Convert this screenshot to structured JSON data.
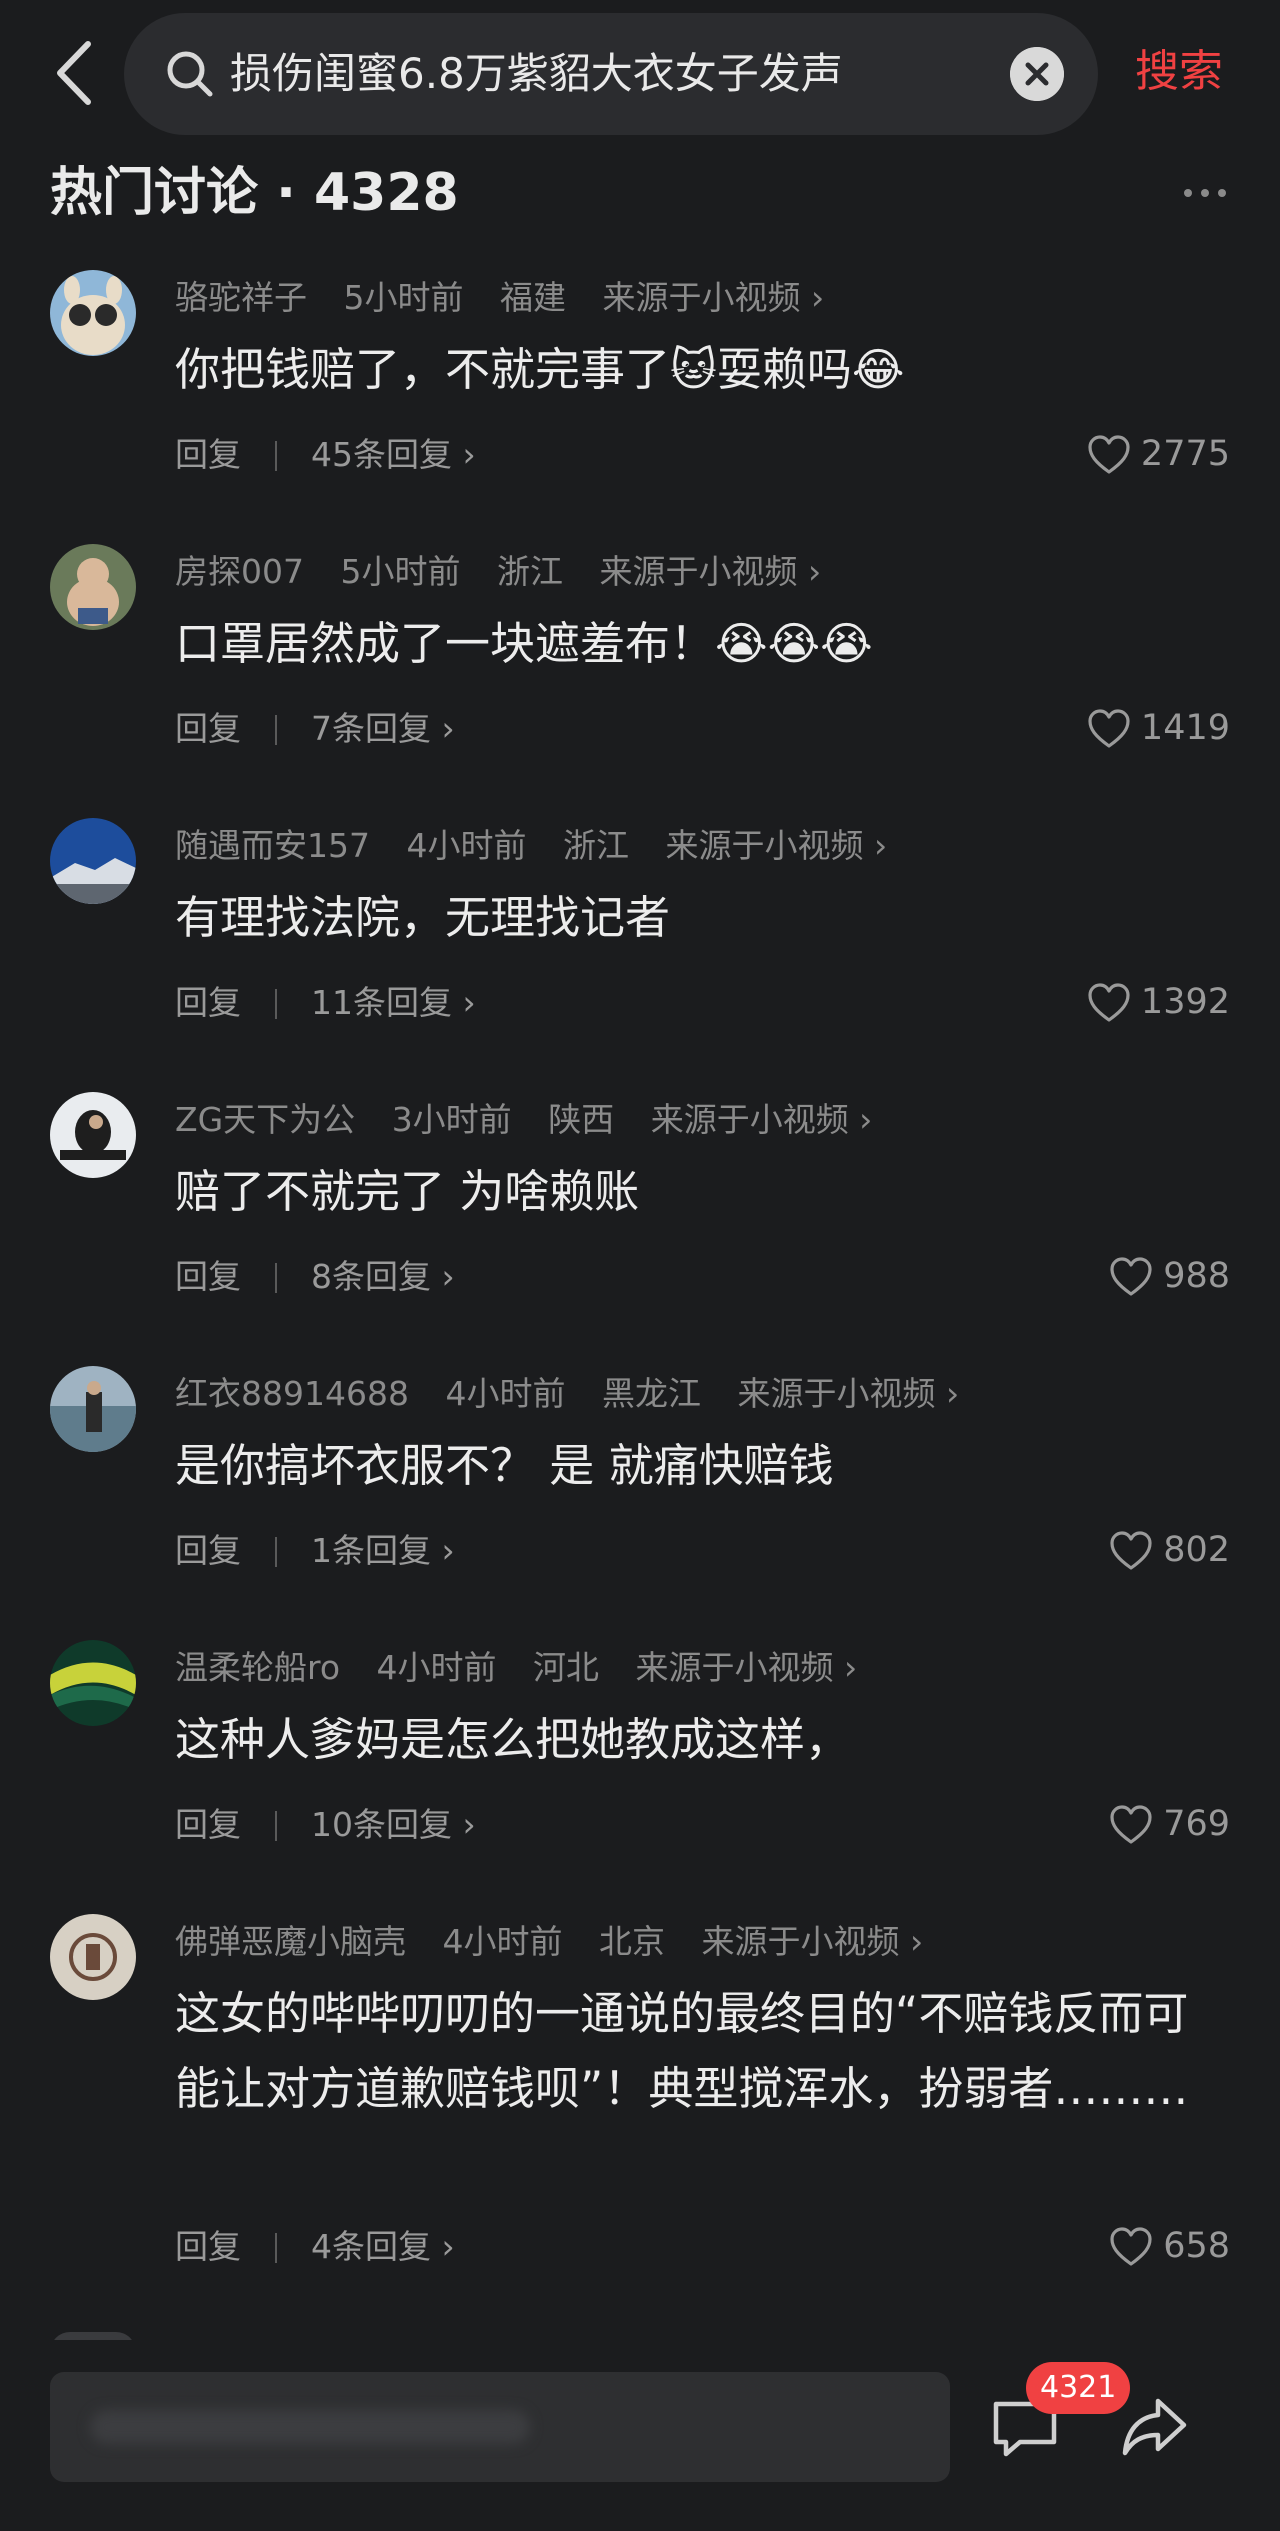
{
  "search": {
    "query": "损伤闺蜜6.8万紫貂大衣女子发声",
    "button_label": "搜索"
  },
  "section": {
    "title": "热门讨论 · 4328"
  },
  "comments": [
    {
      "user": "骆驼祥子",
      "time": "5小时前",
      "location": "福建",
      "source": "来源于小视频 ›",
      "text": "你把钱赔了，不就完事了🐱耍赖吗😂",
      "reply_label": "回复",
      "replies": "45条回复 ›",
      "likes": "2775"
    },
    {
      "user": "房探007",
      "time": "5小时前",
      "location": "浙江",
      "source": "来源于小视频 ›",
      "text": "口罩居然成了一块遮羞布！😭😭😭",
      "reply_label": "回复",
      "replies": "7条回复 ›",
      "likes": "1419"
    },
    {
      "user": "随遇而安157",
      "time": "4小时前",
      "location": "浙江",
      "source": "来源于小视频 ›",
      "text": "有理找法院，无理找记者",
      "reply_label": "回复",
      "replies": "11条回复 ›",
      "likes": "1392"
    },
    {
      "user": "ZG天下为公",
      "time": "3小时前",
      "location": "陕西",
      "source": "来源于小视频 ›",
      "text": "赔了不就完了 为啥赖账",
      "reply_label": "回复",
      "replies": "8条回复 ›",
      "likes": "988"
    },
    {
      "user": "红衣88914688",
      "time": "4小时前",
      "location": "黑龙江",
      "source": "来源于小视频 ›",
      "text": "是你搞坏衣服不？ 是 就痛快赔钱",
      "reply_label": "回复",
      "replies": "1条回复 ›",
      "likes": "802"
    },
    {
      "user": "温柔轮船ro",
      "time": "4小时前",
      "location": "河北",
      "source": "来源于小视频 ›",
      "text": "这种人爹妈是怎么把她教成这样，",
      "reply_label": "回复",
      "replies": "10条回复 ›",
      "likes": "769"
    },
    {
      "user": "佛弹恶魔小脑壳",
      "time": "4小时前",
      "location": "北京",
      "source": "来源于小视频 ›",
      "text": "这女的哔哔叨叨的一通说的最终目的“不赔钱反而可能让对方道歉赔钱呗”！典型搅浑水，扮弱者………",
      "reply_label": "回复",
      "replies": "4条回复 ›",
      "likes": "658"
    }
  ],
  "bottom": {
    "comment_count": "4321"
  },
  "colors": {
    "background": "#1b1c1e",
    "accent": "#f04142"
  },
  "icons": [
    "back-arrow-icon",
    "search-icon",
    "clear-icon",
    "more-icon",
    "heart-icon",
    "comment-icon",
    "share-icon"
  ]
}
